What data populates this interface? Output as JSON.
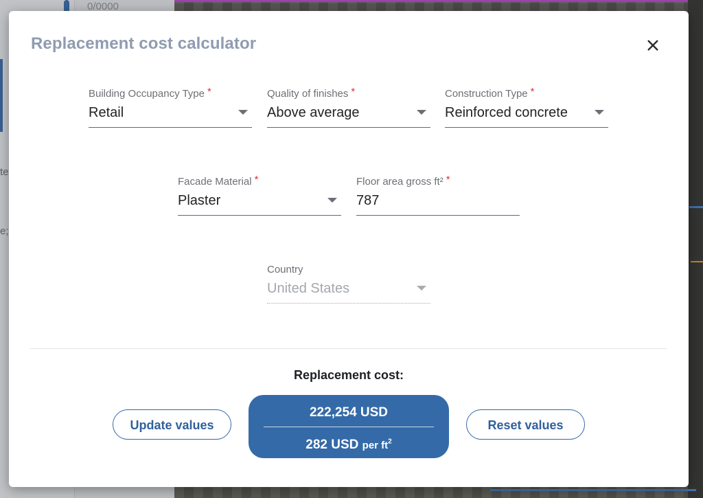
{
  "background": {
    "panel_text": "0/0000",
    "edge_text_1": "te",
    "edge_text_2": "e;"
  },
  "modal": {
    "title": "Replacement cost calculator",
    "close_icon": "close-icon",
    "fields": {
      "occupancy": {
        "label": "Building Occupancy Type",
        "required_mark": "*",
        "value": "Retail"
      },
      "quality": {
        "label": "Quality of finishes",
        "required_mark": "*",
        "value": "Above average"
      },
      "construction": {
        "label": "Construction Type",
        "required_mark": "*",
        "value": "Reinforced concrete"
      },
      "facade": {
        "label": "Facade Material",
        "required_mark": "*",
        "value": "Plaster"
      },
      "floor_area": {
        "label": "Floor area gross ft²",
        "required_mark": "*",
        "value": "787"
      },
      "country": {
        "label": "Country",
        "value": "United States",
        "disabled": true
      }
    },
    "result": {
      "heading": "Replacement cost:",
      "total": "222,254 USD",
      "rate_value": "282 USD",
      "rate_unit": "per ft",
      "rate_exponent": "2"
    },
    "buttons": {
      "update": "Update values",
      "reset": "Reset values"
    }
  },
  "colors": {
    "accent": "#346aa8",
    "title": "#8f9bb0",
    "required": "#e0323c"
  }
}
